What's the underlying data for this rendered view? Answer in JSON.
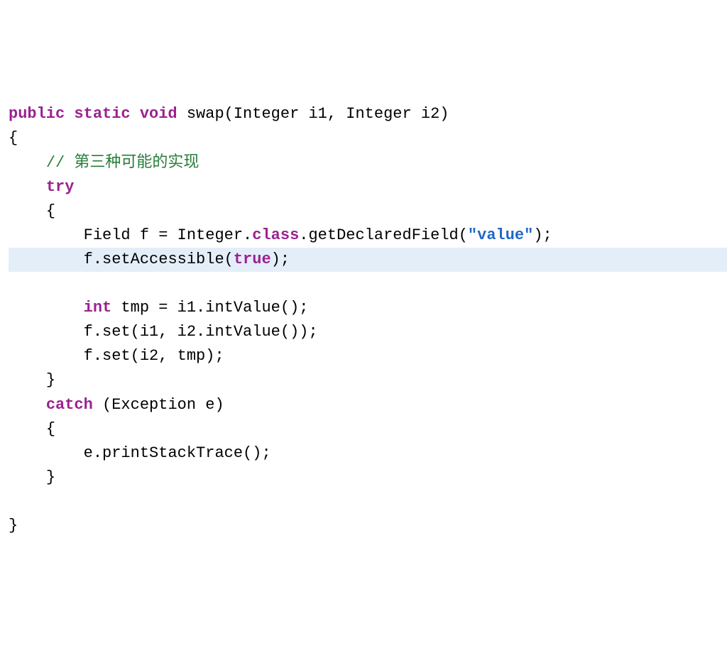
{
  "code": {
    "lines": [
      {
        "indent": 0,
        "highlight": false,
        "tokens": [
          {
            "cls": "kw",
            "text": "public static void"
          },
          {
            "cls": "txt",
            "text": " swap(Integer i1, Integer i2)"
          }
        ]
      },
      {
        "indent": 0,
        "highlight": false,
        "tokens": [
          {
            "cls": "txt",
            "text": "{"
          }
        ]
      },
      {
        "indent": 1,
        "highlight": false,
        "tokens": [
          {
            "cls": "com",
            "text": "// 第三种可能的实现"
          }
        ]
      },
      {
        "indent": 1,
        "highlight": false,
        "tokens": [
          {
            "cls": "kw",
            "text": "try"
          }
        ]
      },
      {
        "indent": 1,
        "highlight": false,
        "tokens": [
          {
            "cls": "txt",
            "text": "{"
          }
        ]
      },
      {
        "indent": 2,
        "highlight": false,
        "tokens": [
          {
            "cls": "txt",
            "text": "Field f = Integer."
          },
          {
            "cls": "sk",
            "text": "class"
          },
          {
            "cls": "txt",
            "text": ".getDeclaredField("
          },
          {
            "cls": "str",
            "text": "\"value\""
          },
          {
            "cls": "txt",
            "text": ");"
          }
        ]
      },
      {
        "indent": 2,
        "highlight": true,
        "tokens": [
          {
            "cls": "txt",
            "text": "f.setAccessible("
          },
          {
            "cls": "sk",
            "text": "true"
          },
          {
            "cls": "txt",
            "text": ");"
          }
        ]
      },
      {
        "indent": 2,
        "highlight": false,
        "tokens": []
      },
      {
        "indent": 2,
        "highlight": false,
        "tokens": [
          {
            "cls": "sk",
            "text": "int"
          },
          {
            "cls": "txt",
            "text": " tmp = i1.intValue();"
          }
        ]
      },
      {
        "indent": 2,
        "highlight": false,
        "tokens": [
          {
            "cls": "txt",
            "text": "f.set(i1, i2.intValue());"
          }
        ]
      },
      {
        "indent": 2,
        "highlight": false,
        "tokens": [
          {
            "cls": "txt",
            "text": "f.set(i2, tmp);"
          }
        ]
      },
      {
        "indent": 1,
        "highlight": false,
        "tokens": [
          {
            "cls": "txt",
            "text": "}"
          }
        ]
      },
      {
        "indent": 1,
        "highlight": false,
        "tokens": [
          {
            "cls": "kw",
            "text": "catch"
          },
          {
            "cls": "txt",
            "text": " (Exception e)"
          }
        ]
      },
      {
        "indent": 1,
        "highlight": false,
        "tokens": [
          {
            "cls": "txt",
            "text": "{"
          }
        ]
      },
      {
        "indent": 2,
        "highlight": false,
        "tokens": [
          {
            "cls": "txt",
            "text": "e.printStackTrace();"
          }
        ]
      },
      {
        "indent": 1,
        "highlight": false,
        "tokens": [
          {
            "cls": "txt",
            "text": "}"
          }
        ]
      },
      {
        "indent": 0,
        "highlight": false,
        "tokens": []
      },
      {
        "indent": 0,
        "highlight": false,
        "tokens": [
          {
            "cls": "txt",
            "text": "}"
          }
        ]
      }
    ]
  },
  "indent_unit": "    "
}
